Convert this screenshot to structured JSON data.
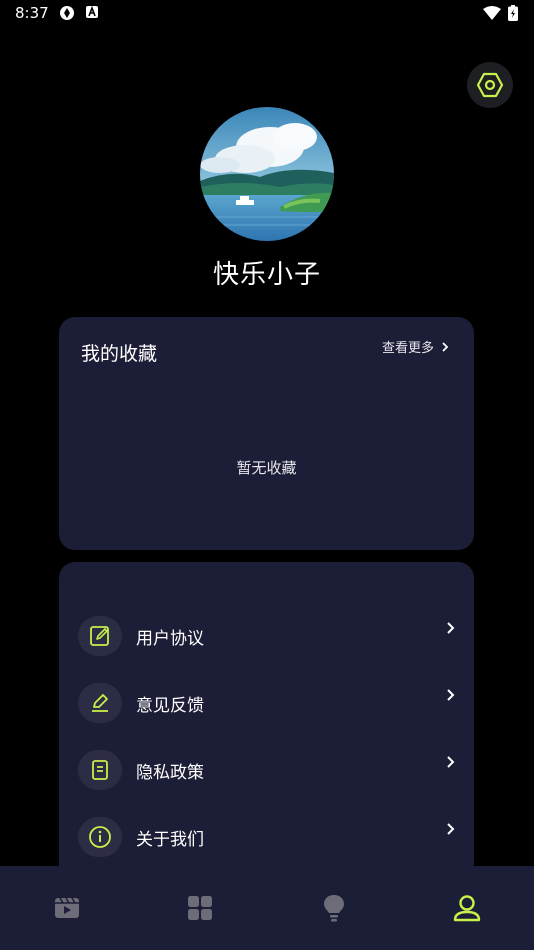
{
  "status_bar": {
    "time": "8:37"
  },
  "profile": {
    "username": "快乐小子"
  },
  "favorites": {
    "title": "我的收藏",
    "more_label": "查看更多",
    "empty_text": "暂无收藏"
  },
  "menu": {
    "items": [
      {
        "label": "用户协议",
        "icon": "edit-document-icon"
      },
      {
        "label": "意见反馈",
        "icon": "pencil-icon"
      },
      {
        "label": "隐私政策",
        "icon": "document-icon"
      },
      {
        "label": "关于我们",
        "icon": "info-icon"
      }
    ]
  },
  "tab_bar": {
    "tabs": [
      {
        "icon": "video-icon",
        "active": false
      },
      {
        "icon": "grid-icon",
        "active": false
      },
      {
        "icon": "lightbulb-icon",
        "active": false
      },
      {
        "icon": "user-icon",
        "active": true
      }
    ]
  },
  "colors": {
    "accent": "#c8f04a",
    "card_bg": "#1c1d36",
    "icon_bg": "#2c2d45",
    "inactive_icon": "#6c6d78"
  }
}
